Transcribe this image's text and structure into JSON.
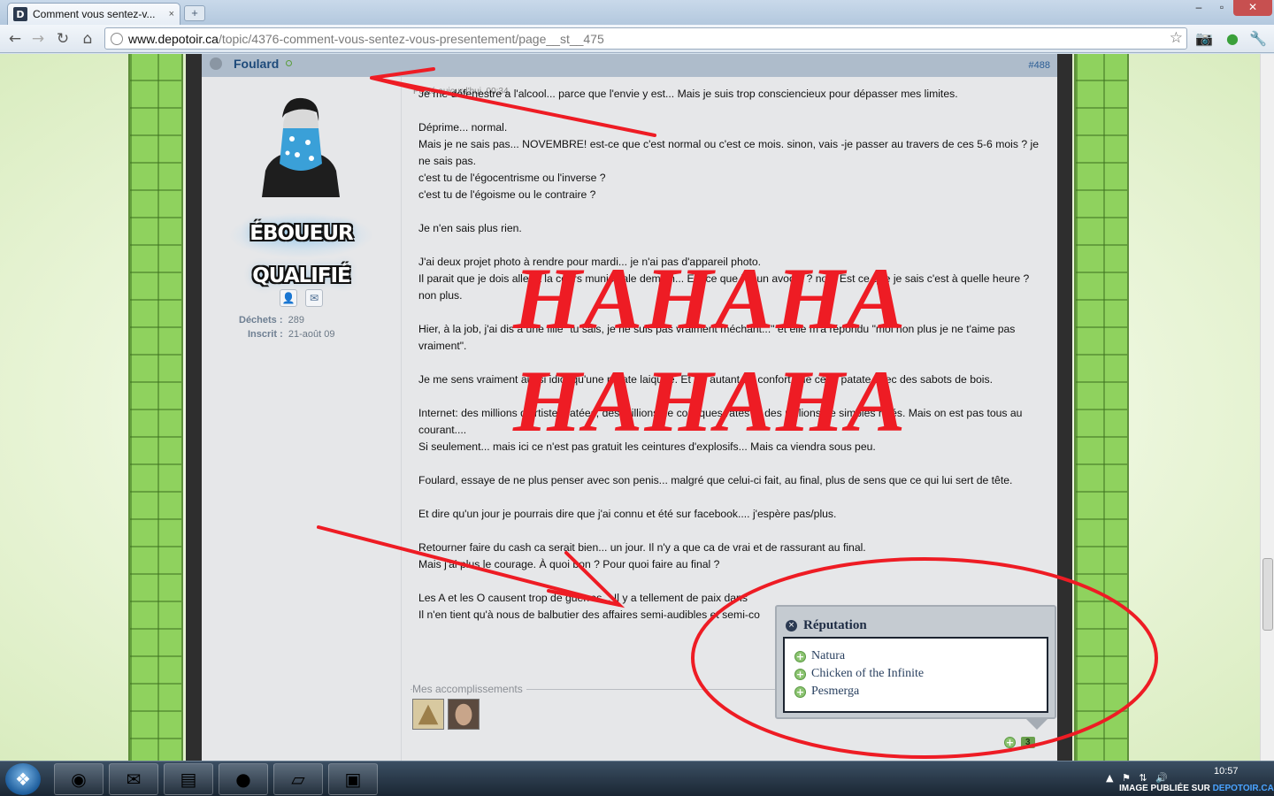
{
  "browser": {
    "tab_title": "Comment vous sentez-v...",
    "tab_favicon": "D",
    "tab_close": "×",
    "new_tab": "+",
    "url_host": "www.depotoir.ca",
    "url_path": "/topic/4376-comment-vous-sentez-vous-presentement/page__st__475",
    "window_controls": [
      "–",
      "▫",
      "✕"
    ],
    "nav": {
      "back": "←",
      "forward": "→",
      "reload": "↻",
      "home": "⌂"
    },
    "star": "☆",
    "toolbar_icons": {
      "camera": "📷",
      "extension": "●",
      "wrench": "🔧"
    }
  },
  "post": {
    "author": "Foulard",
    "post_number": "#488",
    "posted_label": "Posté aujourd'hui, 00:34",
    "rank_text": "ÉBOUEUR QUALIFIÉ",
    "profile_icon": "👤",
    "message_icon": "✉",
    "stats": {
      "dechets_label": "Déchets :",
      "dechets_value": "289",
      "inscrit_label": "Inscrit :",
      "inscrit_value": "21-août 09"
    },
    "paragraphs": [
      "Je me défenestre a l'alcool... parce que l'envie y est... Mais je suis trop consciencieux pour dépasser mes limites.",
      "Déprime... normal.\nMais je ne sais pas... NOVEMBRE! est-ce que c'est normal ou c'est ce mois. sinon, vais -je passer au travers de ces 5-6 mois ? je ne sais pas.\nc'est tu de l'égocentrisme ou l'inverse ?\nc'est tu de l'égoisme ou le contraire ?",
      "Je n'en sais plus rien.",
      "J'ai deux projet photo à rendre pour mardi... je n'ai pas d'appareil photo.\nIl parait que je dois aller à la cours municipale demain... Est ce que j'ai un avocat ? non. Est ce que je sais c'est à quelle heure ? non plus.",
      "Hier, à la job, j'ai dis a une fille \"tu sais, je ne suis pas vraiment méchant...\" et elle m'a répondu \"moi non plus je ne t'aime pas vraiment\".",
      "Je me sens vraiment aussi idiot qu'une patate laiquée. Et j'ai autant de confort que cette patate avec des sabots de bois.",
      "Internet: des millions d'artistes ratées, des millions de comiques ratés et des millions de simples ratés. Mais on est pas tous au courant....\nSi seulement... mais ici ce n'est pas gratuit les ceintures d'explosifs... Mais ca viendra sous peu.",
      "Foulard, essaye de ne plus penser avec son penis... malgré que celui-ci fait, au final, plus de sens que ce qui lui sert de tête.",
      "Et dire qu'un jour je pourrais dire que j'ai connu et été sur facebook.... j'espère pas/plus.",
      "Retourner faire du cash ca serait bien... un jour. Il n'y a que ca de vrai et de rassurant au final.\nMais j'ai plus le courage. À quoi bon ? Pour quoi faire au final ?",
      "Les A et les O causent trop de guerres... Il y a tellement de paix dans\nIl n'en tient qu'à nous de balbutier des affaires semi-audibles et semi-co"
    ],
    "accomplishments_label": "Mes accomplissements"
  },
  "reputation": {
    "title": "Réputation",
    "close_icon": "×",
    "users": [
      "Natura",
      "Chicken of the Infinite",
      "Pesmerga"
    ],
    "count": "3"
  },
  "overlay": {
    "line1": "HAHAHA",
    "line2": "HAHAHA",
    "color": "#ee1c24"
  },
  "taskbar": {
    "start_icon": "❖",
    "apps": [
      "chrome-icon",
      "mail-icon",
      "folder-icon",
      "app-icon",
      "notes-icon",
      "archive-icon"
    ],
    "tray": "▲ ⚑ ⇅ 🔊",
    "time": "10:57",
    "watermark_prefix": "IMAGE PUBLIÉE SUR",
    "watermark_site": "DEPOTOIR.CA"
  }
}
